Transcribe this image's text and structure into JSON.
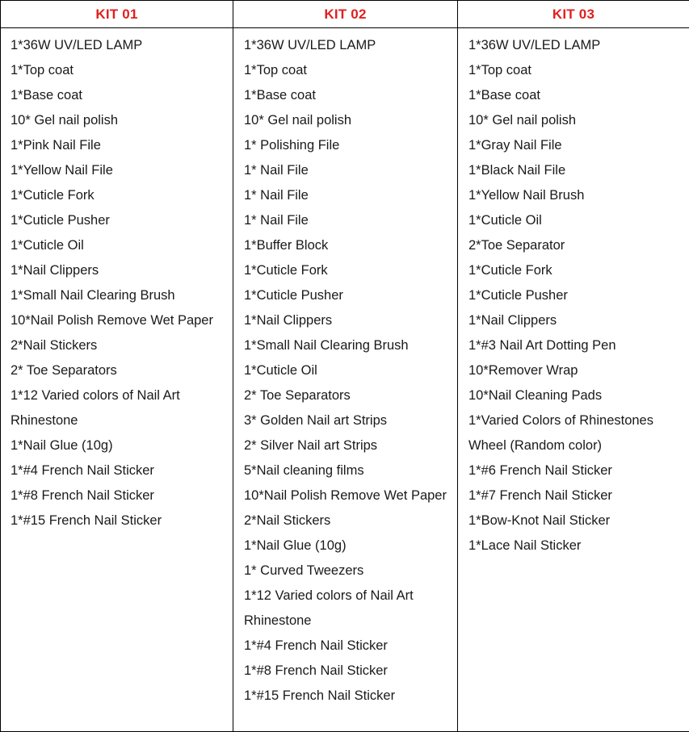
{
  "table": {
    "columns": [
      {
        "header": "KIT 01",
        "items": [
          "1*36W UV/LED LAMP",
          "1*Top coat",
          "1*Base coat",
          "10* Gel nail polish",
          "1*Pink Nail File",
          "1*Yellow Nail File",
          "1*Cuticle Fork",
          "1*Cuticle Pusher",
          "1*Cuticle Oil",
          "1*Nail Clippers",
          "1*Small Nail Clearing Brush",
          "10*Nail Polish Remove Wet Paper",
          "2*Nail Stickers",
          "2* Toe Separators",
          "1*12 Varied colors of Nail Art Rhinestone",
          "1*Nail Glue (10g)",
          "1*#4 French Nail Sticker",
          "1*#8 French Nail Sticker",
          "1*#15 French Nail Sticker"
        ]
      },
      {
        "header": "KIT 02",
        "items": [
          "1*36W UV/LED LAMP",
          "1*Top coat",
          "1*Base coat",
          "10* Gel nail polish",
          "1* Polishing File",
          "1* Nail File",
          "1* Nail File",
          "1* Nail File",
          "1*Buffer Block",
          "1*Cuticle Fork",
          "1*Cuticle Pusher",
          "1*Nail Clippers",
          "1*Small Nail Clearing Brush",
          "1*Cuticle Oil",
          "2* Toe Separators",
          "3* Golden Nail art Strips",
          "2* Silver Nail art Strips",
          "5*Nail cleaning films",
          "10*Nail Polish Remove Wet Paper",
          "2*Nail Stickers",
          "1*Nail Glue (10g)",
          "1* Curved Tweezers",
          "1*12 Varied colors of Nail Art Rhinestone",
          "1*#4 French Nail Sticker",
          "1*#8 French Nail Sticker",
          "1*#15 French Nail Sticker"
        ]
      },
      {
        "header": "KIT 03",
        "items": [
          "1*36W UV/LED LAMP",
          "1*Top coat",
          "1*Base coat",
          "10* Gel nail polish",
          "1*Gray Nail File",
          "1*Black Nail File",
          "1*Yellow Nail Brush",
          "1*Cuticle Oil",
          "2*Toe Separator",
          "1*Cuticle Fork",
          "1*Cuticle Pusher",
          "1*Nail Clippers",
          "1*#3 Nail Art Dotting Pen",
          "10*Remover Wrap",
          "10*Nail Cleaning Pads",
          "1*Varied Colors of Rhinestones Wheel (Random color)",
          "1*#6 French Nail Sticker",
          "1*#7 French Nail Sticker",
          "1*Bow-Knot Nail Sticker",
          "1*Lace Nail Sticker"
        ]
      }
    ]
  },
  "colors": {
    "header_text": "#E02020",
    "body_text": "#1a1a1a",
    "border": "#000000",
    "background": "#ffffff"
  }
}
